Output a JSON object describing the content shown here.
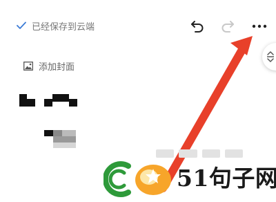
{
  "header": {
    "save_status": "已经保存到云端",
    "icons": {
      "saved": "check-icon",
      "undo": "undo-icon",
      "redo": "redo-icon",
      "more": "more-dots-icon",
      "side": "expand-collapse-icon"
    }
  },
  "editor": {
    "add_cover_label": "添加封面",
    "add_cover_icon": "image-icon"
  },
  "annotation": {
    "arrow_color": "#e8402a"
  },
  "watermark": {
    "brand_text": "51句子网",
    "green": "#2e9a3a",
    "orange": "#f7a52a"
  },
  "colors": {
    "accent": "#3b7bd6"
  }
}
